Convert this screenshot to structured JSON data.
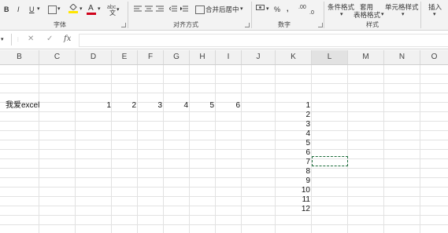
{
  "ribbon": {
    "bold": "B",
    "italic": "I",
    "underline": "U",
    "font_color_label": "A",
    "wrap_text_label": "abc",
    "merge_center": "合并后居中",
    "percent": "%",
    "comma": ",",
    "decimals": ".00",
    "conditional_format": "条件格式",
    "table_format_line1": "套用",
    "table_format_line2": "表格格式",
    "cell_styles": "单元格样式",
    "insert": "插入",
    "groups": {
      "font": "字体",
      "alignment": "对齐方式",
      "number": "数字",
      "styles": "样式"
    }
  },
  "formula_bar": {
    "cancel": "✕",
    "enter": "✓",
    "fx": "fx",
    "value": ""
  },
  "columns": [
    "B",
    "C",
    "D",
    "E",
    "F",
    "G",
    "H",
    "I",
    "J",
    "K",
    "L",
    "M",
    "N",
    "O"
  ],
  "cells": {
    "b_text": "我爱excel",
    "row_numbers": [
      "1",
      "2",
      "3",
      "4",
      "5",
      "6"
    ],
    "k_column": [
      "1",
      "2",
      "3",
      "4",
      "5",
      "6",
      "7",
      "8",
      "9",
      "10",
      "11",
      "12"
    ]
  },
  "colors": {
    "selection_border": "#1d6d3c",
    "ribbon_bg": "#f3f3f3",
    "highlight_yellow": "#ffe600",
    "font_red": "#d0021b"
  }
}
